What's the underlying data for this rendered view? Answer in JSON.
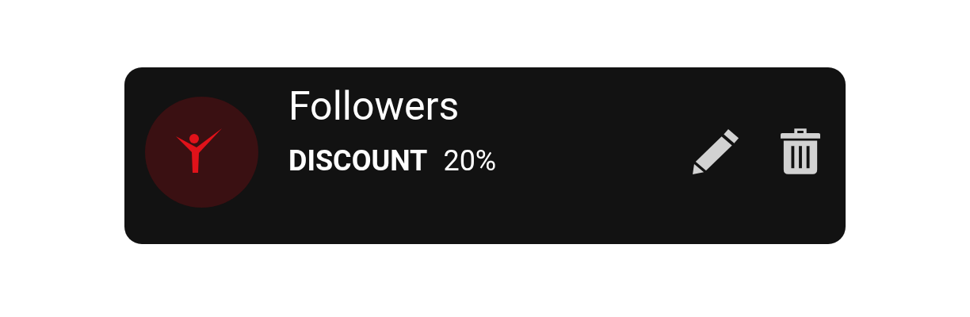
{
  "card": {
    "title": "Followers",
    "label": "DISCOUNT",
    "value": "20%",
    "actions": [
      {
        "kind": "edit"
      },
      {
        "kind": "delete"
      }
    ]
  }
}
